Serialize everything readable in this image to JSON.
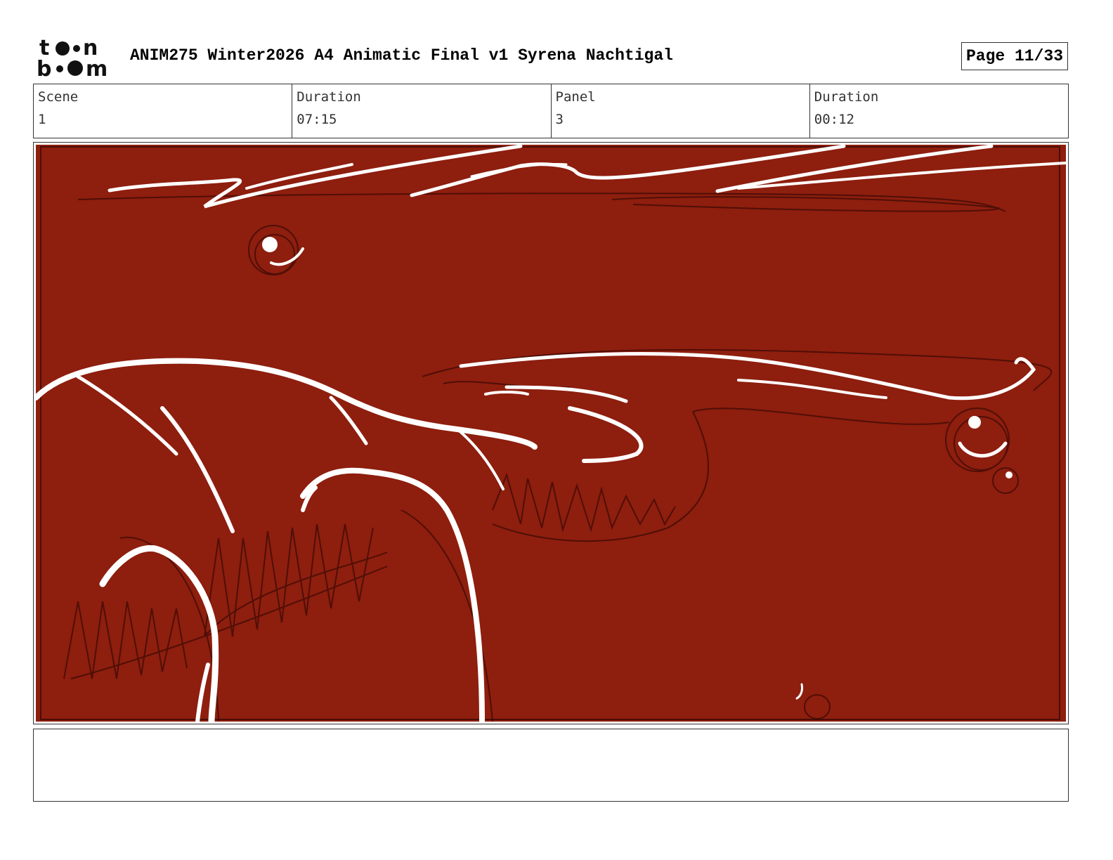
{
  "header": {
    "logo_line1": "toon",
    "logo_line2": "boom",
    "title": "ANIM275 Winter2026 A4 Animatic Final v1 Syrena Nachtigal",
    "page": "Page 11/33"
  },
  "info": [
    {
      "label": "Scene",
      "value": "1"
    },
    {
      "label": "Duration",
      "value": "07:15"
    },
    {
      "label": "Panel",
      "value": "3"
    },
    {
      "label": "Duration",
      "value": "00:12"
    }
  ],
  "panel": {
    "background_color": "#8e1e0e",
    "stroke_color": "#ffffff",
    "sketch_color": "#3a0a05"
  },
  "notes": {
    "text": ""
  }
}
